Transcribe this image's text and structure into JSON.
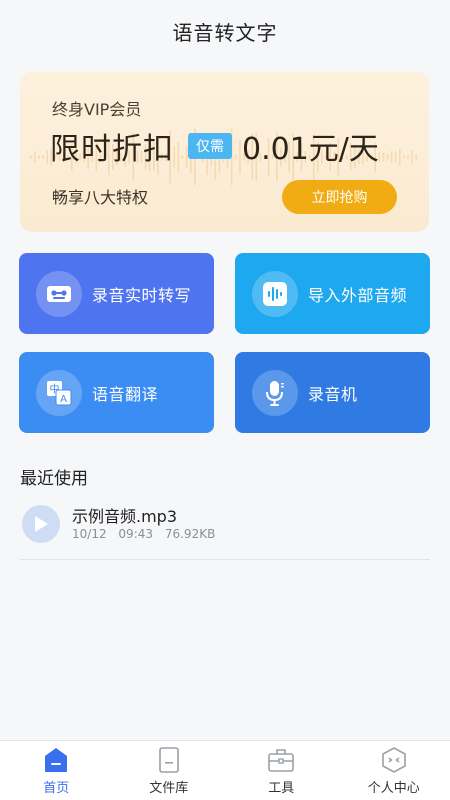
{
  "header": {
    "title": "语音转文字"
  },
  "vip": {
    "title": "终身VIP会员",
    "headline": "限时折扣",
    "badge": "仅需",
    "price": "0.01元/天",
    "subtitle": "畅享八大特权",
    "button": "立即抢购"
  },
  "features": [
    {
      "label": "录音实时转写",
      "icon": "tape-icon"
    },
    {
      "label": "导入外部音频",
      "icon": "waveform-icon"
    },
    {
      "label": "语音翻译",
      "icon": "translate-icon"
    },
    {
      "label": "录音机",
      "icon": "microphone-icon"
    }
  ],
  "recent": {
    "title": "最近使用",
    "files": [
      {
        "name": "示例音频.mp3",
        "date": "10/12",
        "time": "09:43",
        "size": "76.92KB"
      }
    ]
  },
  "tabbar": {
    "items": [
      {
        "label": "首页",
        "icon": "home-icon",
        "active": true
      },
      {
        "label": "文件库",
        "icon": "file-icon",
        "active": false
      },
      {
        "label": "工具",
        "icon": "toolbox-icon",
        "active": false
      },
      {
        "label": "个人中心",
        "icon": "profile-icon",
        "active": false
      }
    ]
  },
  "colors": {
    "accent": "#3a6ff0",
    "vip_button": "#f2ac13",
    "badge": "#4bb6f2",
    "card1": "#4f74f0",
    "card2": "#1ea8ef",
    "card3": "#3b8cf3",
    "card4": "#2f7be3"
  }
}
